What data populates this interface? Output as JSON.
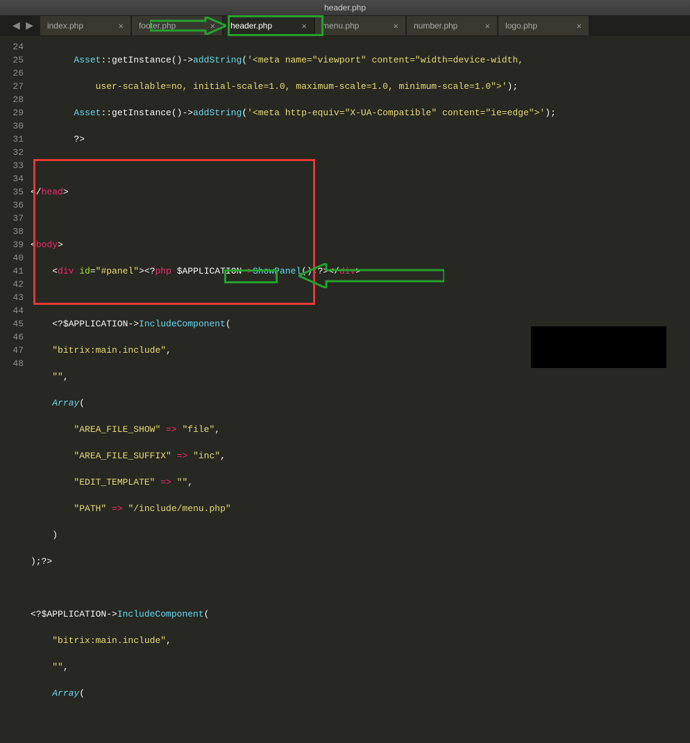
{
  "title_bar": "header.php",
  "nav": {
    "left": "◀",
    "right": "▶"
  },
  "tabs": [
    {
      "label": "index.php",
      "active": false
    },
    {
      "label": "footer.php",
      "active": false
    },
    {
      "label": "header.php",
      "active": true
    },
    {
      "label": "menu.php",
      "active": false
    },
    {
      "label": "number.php",
      "active": false
    },
    {
      "label": "logo.php",
      "active": false
    }
  ],
  "tab_close": "×",
  "line_numbers": [
    "24",
    "25",
    "",
    "26",
    "27",
    "28",
    "29",
    "30",
    "31",
    "32",
    "33",
    "34",
    "35",
    "36",
    "37",
    "38",
    "39",
    "40",
    "41",
    "42",
    "43",
    "44",
    "45",
    "46",
    "47",
    "48"
  ],
  "code": {
    "l24_a": "Asset",
    "l24_b": "::getInstance()->",
    "l24_c": "addString",
    "l24_d": "(",
    "l24_e": "'<meta name=\"viewport\" content=\"width=device-width,",
    "l24_e2": ")",
    "l24_e3": ";",
    "l25_a": "user-scalable=no, initial-scale=1.0, maximum-scale=1.0, minimum-scale=1.0\">'",
    "l26_a": "Asset",
    "l26_b": "::getInstance()->",
    "l26_c": "addString",
    "l26_d": "(",
    "l26_e": "'<meta http-equiv=\"X-UA-Compatible\" content=\"ie=edge\">'",
    "l26_f": ");",
    "l27_a": "?>",
    "l29_a": "</",
    "l29_b": "head",
    "l29_c": ">",
    "l31_a": "<",
    "l31_b": "body",
    "l31_c": ">",
    "l32_a": "<",
    "l32_b": "div",
    "l32_c": " id",
    "l32_d": "=",
    "l32_e": "\"#panel\"",
    "l32_f": ">",
    "l32_g": "<?",
    "l32_h": "php",
    "l32_i": " $APPLICATION",
    "l32_j": "->",
    "l32_k": "ShowPanel",
    "l32_l": "();",
    "l32_m": "?>",
    "l32_n": "</",
    "l32_o": "div",
    "l32_p": ">",
    "l34_a": "<?$APPLICATION->",
    "l34_b": "IncludeComponent",
    "l34_c": "(",
    "l35_a": "\"bitrix:main.include\"",
    "l35_b": ",",
    "l36_a": "\"\"",
    "l36_b": ",",
    "l37_a": "Array",
    "l37_b": "(",
    "l38_a": "\"AREA_FILE_SHOW\"",
    "l38_b": " => ",
    "l38_c": "\"file\"",
    "l38_d": ",",
    "l39_a": "\"AREA_FILE_SUFFIX\"",
    "l39_b": " => ",
    "l39_c": "\"inc\"",
    "l39_d": ",",
    "l40_a": "\"EDIT_TEMPLATE\"",
    "l40_b": " => ",
    "l40_c": "\"\"",
    "l40_d": ",",
    "l41_a": "\"PATH\"",
    "l41_b": " => ",
    "l41_c": "\"/include/menu.php\"",
    "l42_a": ")",
    "l43_a": ");",
    "l43_b": "?>",
    "l45_a": "<?$APPLICATION->",
    "l45_b": "IncludeComponent",
    "l45_c": "(",
    "l46_a": "\"bitrix:main.include\"",
    "l46_b": ",",
    "l47_a": "\"\"",
    "l47_b": ",",
    "l48_a": "Array",
    "l48_b": "("
  },
  "colors": {
    "green": "#25a12e",
    "red": "#e63838"
  }
}
